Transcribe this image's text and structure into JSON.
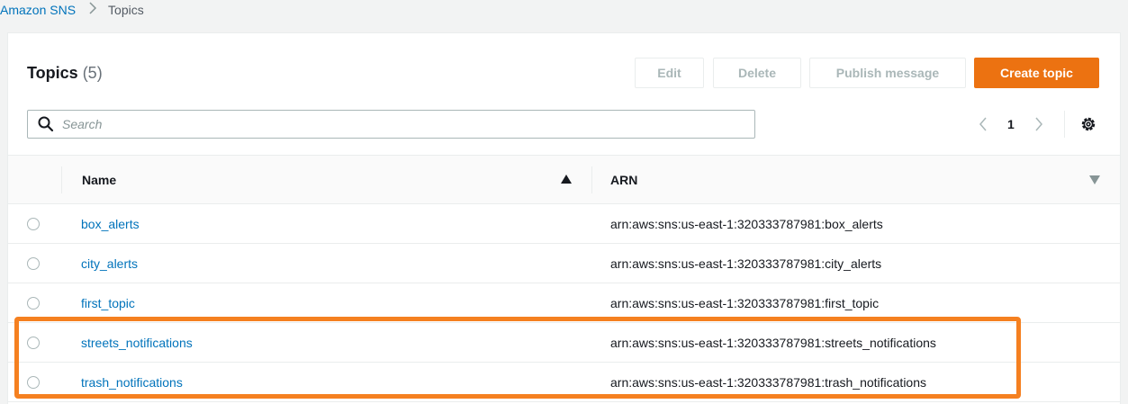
{
  "breadcrumb": {
    "service": "Amazon SNS",
    "current": "Topics"
  },
  "panel": {
    "title": "Topics",
    "count": "(5)"
  },
  "actions": {
    "edit": "Edit",
    "delete": "Delete",
    "publish": "Publish message",
    "create": "Create topic"
  },
  "search": {
    "placeholder": "Search",
    "value": ""
  },
  "pagination": {
    "current_page": "1"
  },
  "table": {
    "columns": {
      "name": "Name",
      "arn": "ARN"
    },
    "rows": [
      {
        "name": "box_alerts",
        "arn": "arn:aws:sns:us-east-1:320333787981:box_alerts"
      },
      {
        "name": "city_alerts",
        "arn": "arn:aws:sns:us-east-1:320333787981:city_alerts"
      },
      {
        "name": "first_topic",
        "arn": "arn:aws:sns:us-east-1:320333787981:first_topic"
      },
      {
        "name": "streets_notifications",
        "arn": "arn:aws:sns:us-east-1:320333787981:streets_notifications"
      },
      {
        "name": "trash_notifications",
        "arn": "arn:aws:sns:us-east-1:320333787981:trash_notifications"
      }
    ]
  },
  "colors": {
    "link": "#0073bb",
    "primary": "#ec7211",
    "highlight": "#f58020"
  }
}
